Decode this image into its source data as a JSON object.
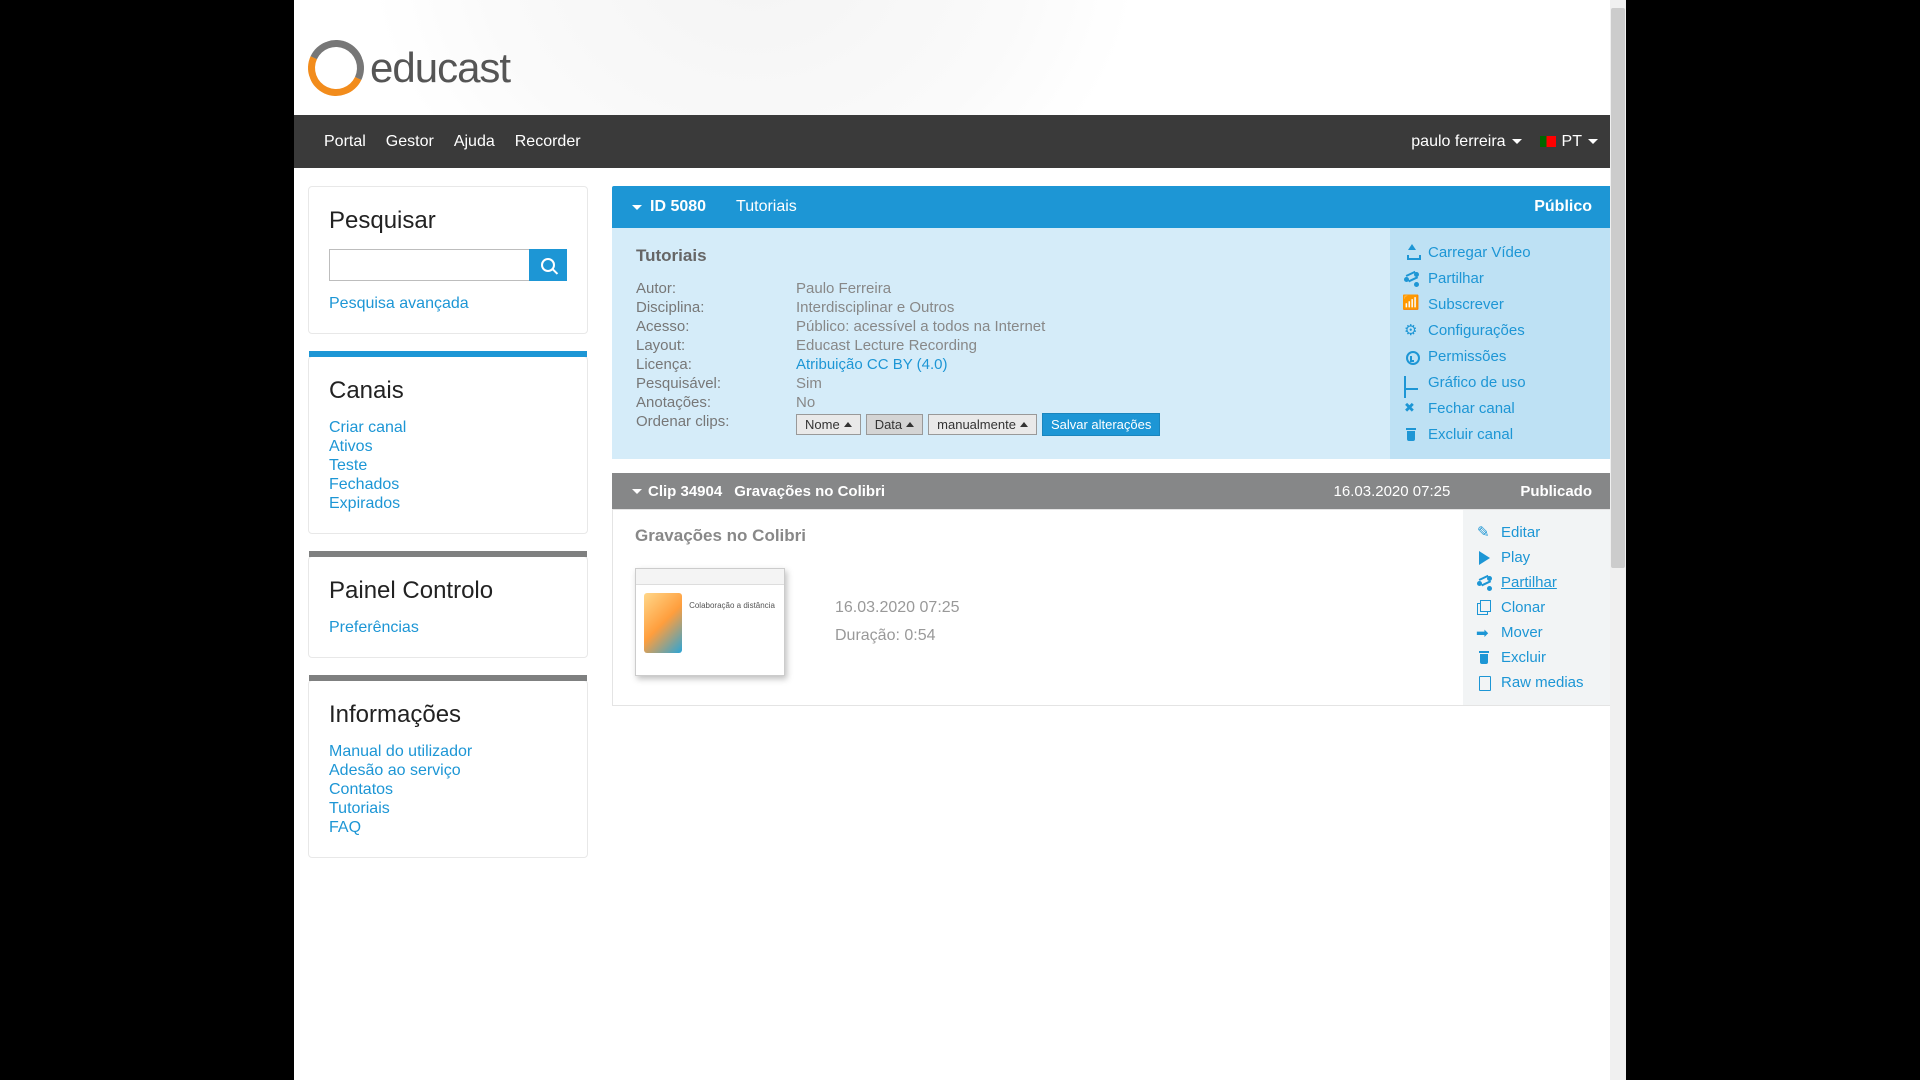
{
  "brand": "educast",
  "nav": {
    "portal": "Portal",
    "gestor": "Gestor",
    "ajuda": "Ajuda",
    "recorder": "Recorder",
    "user": "paulo ferreira",
    "lang": "PT"
  },
  "search": {
    "title": "Pesquisar",
    "placeholder": "",
    "advanced": "Pesquisa avançada"
  },
  "canais": {
    "title": "Canais",
    "links": [
      "Criar canal",
      "Ativos",
      "Teste",
      "Fechados",
      "Expirados"
    ]
  },
  "painel": {
    "title": "Painel Controlo",
    "links": [
      "Preferências"
    ]
  },
  "info": {
    "title": "Informações",
    "links": [
      "Manual do utilizador",
      "Adesão ao serviço",
      "Contatos",
      "Tutoriais",
      "FAQ"
    ]
  },
  "channel": {
    "badge_id": "ID 5080",
    "name_hdr": "Tutoriais",
    "status": "Público",
    "title": "Tutoriais",
    "meta": {
      "autor_l": "Autor:",
      "autor_v": "Paulo Ferreira",
      "disc_l": "Disciplina:",
      "disc_v": "Interdisciplinar e Outros",
      "acesso_l": "Acesso:",
      "acesso_v": "Público: acessível a todos na Internet",
      "layout_l": "Layout:",
      "layout_v": "Educast Lecture Recording",
      "licenca_l": "Licença:",
      "licenca_v": "Atribuição CC BY (4.0)",
      "pesq_l": "Pesquisável:",
      "pesq_v": "Sim",
      "anot_l": "Anotações:",
      "anot_v": "No",
      "ord_l": "Ordenar clips:"
    },
    "order": {
      "nome": "Nome",
      "data": "Data",
      "manual": "manualmente",
      "save": "Salvar alterações"
    },
    "actions": {
      "upload": "Carregar Vídeo",
      "partilhar": "Partilhar",
      "sub": "Subscrever",
      "conf": "Configurações",
      "perm": "Permissões",
      "graf": "Gráfico de uso",
      "fechar": "Fechar canal",
      "excluir": "Excluir canal"
    }
  },
  "clip": {
    "id": "Clip 34904",
    "name_hdr": "Gravações no Colibri",
    "date_hdr": "16.03.2020 07:25",
    "status": "Publicado",
    "title": "Gravações no Colibri",
    "thumb_caption": "Colaboração a distância",
    "date": "16.03.2020 07:25",
    "duration": "Duração: 0:54",
    "actions": {
      "editar": "Editar",
      "play": "Play",
      "partilhar": "Partilhar",
      "clonar": "Clonar",
      "mover": "Mover",
      "excluir": "Excluir",
      "raw": "Raw medias"
    }
  }
}
